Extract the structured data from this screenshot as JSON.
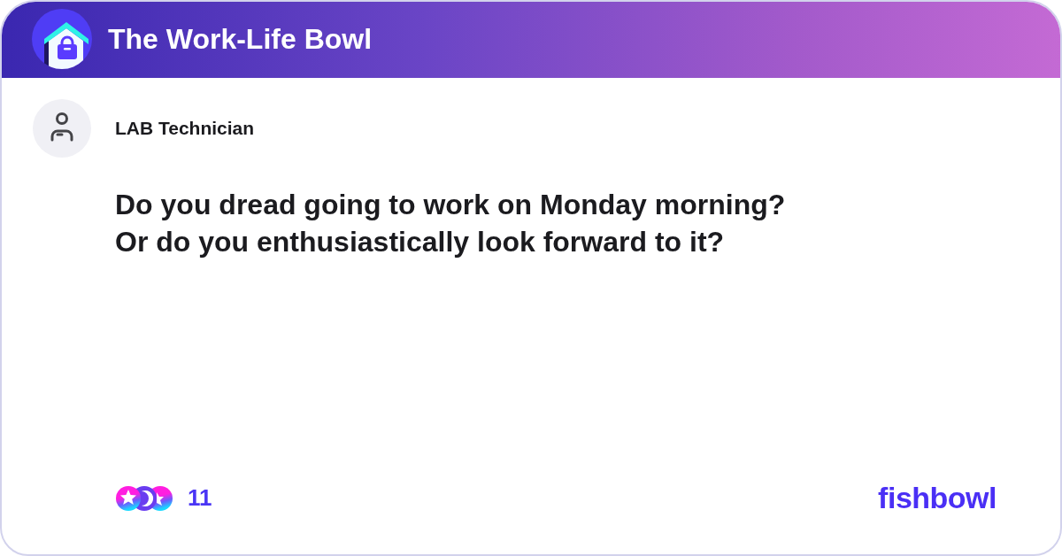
{
  "header": {
    "title": "The Work-Life Bowl"
  },
  "post": {
    "author": "LAB Technician",
    "question": "Do you dread going to work on Monday morning?\nOr do you enthusiastically look forward to it?"
  },
  "footer": {
    "reaction_count": "11",
    "brand": "fishbowl"
  }
}
